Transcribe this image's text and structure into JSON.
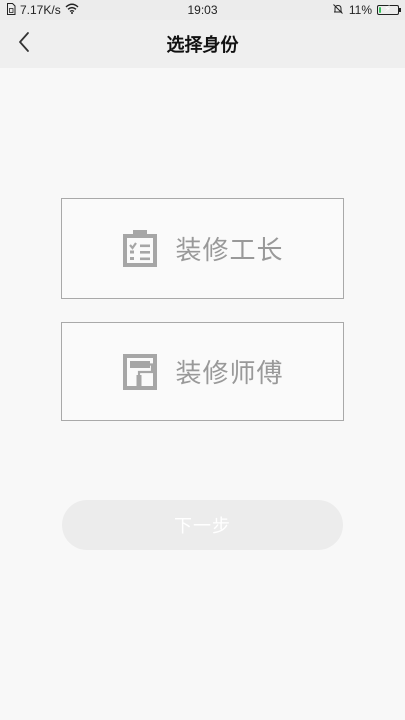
{
  "status_bar": {
    "network_speed": "7.17K/s",
    "time": "19:03",
    "battery_percent": "11%",
    "battery_level": 0.11,
    "icons": [
      "sim-icon",
      "wifi-icon",
      "silent-icon",
      "battery-icon"
    ]
  },
  "header": {
    "title": "选择身份",
    "back_icon": "chevron-left-icon"
  },
  "options": [
    {
      "label": "装修工长",
      "icon": "clipboard-checklist-icon"
    },
    {
      "label": "装修师傅",
      "icon": "paint-roller-icon"
    }
  ],
  "next_button": {
    "label": "下一步",
    "enabled": false
  },
  "colors": {
    "background": "#f8f8f8",
    "header_bg": "#efefef",
    "card_border": "#a9a9a9",
    "card_text": "#999999",
    "icon": "#a6a6a6",
    "disabled_button_bg": "#ececec",
    "battery_green": "#35c35a"
  }
}
